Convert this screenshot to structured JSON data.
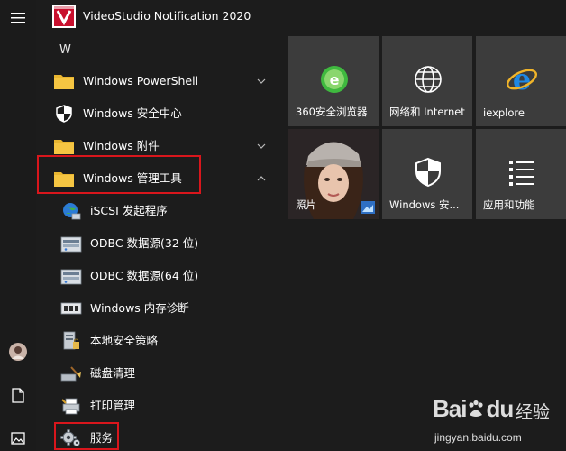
{
  "app": {
    "title": "VideoStudio Notification 2020"
  },
  "list": {
    "section_letter": "W",
    "items": [
      {
        "label": "Windows PowerShell",
        "expanded": false
      },
      {
        "label": "Windows 安全中心"
      },
      {
        "label": "Windows 附件",
        "expanded": false
      },
      {
        "label": "Windows 管理工具",
        "expanded": true
      }
    ],
    "sub_items": [
      {
        "label": "iSCSI 发起程序"
      },
      {
        "label": "ODBC 数据源(32 位)"
      },
      {
        "label": "ODBC 数据源(64 位)"
      },
      {
        "label": "Windows 内存诊断"
      },
      {
        "label": "本地安全策略"
      },
      {
        "label": "磁盘清理"
      },
      {
        "label": "打印管理"
      },
      {
        "label": "服务"
      }
    ]
  },
  "tiles": [
    {
      "label": "360安全浏览器",
      "icon": "360-browser-icon"
    },
    {
      "label": "网络和 Internet",
      "icon": "globe-icon"
    },
    {
      "label": "iexplore",
      "icon": "ie-icon"
    },
    {
      "label": "照片",
      "icon": "photos-icon"
    },
    {
      "label": "Windows 安...",
      "icon": "shield-icon"
    },
    {
      "label": "应用和功能",
      "icon": "app-list-icon"
    }
  ],
  "watermark": {
    "brand": "Bai",
    "brand2": "du",
    "cn": "经验",
    "url": "jingyan.baidu.com"
  },
  "colors": {
    "background": "#1c1c1c",
    "tile": "#3c3c3c",
    "highlight": "#d9161c",
    "folder": "#f5c542",
    "ie_blue": "#1e88e5",
    "green_360": "#3fb93f"
  }
}
